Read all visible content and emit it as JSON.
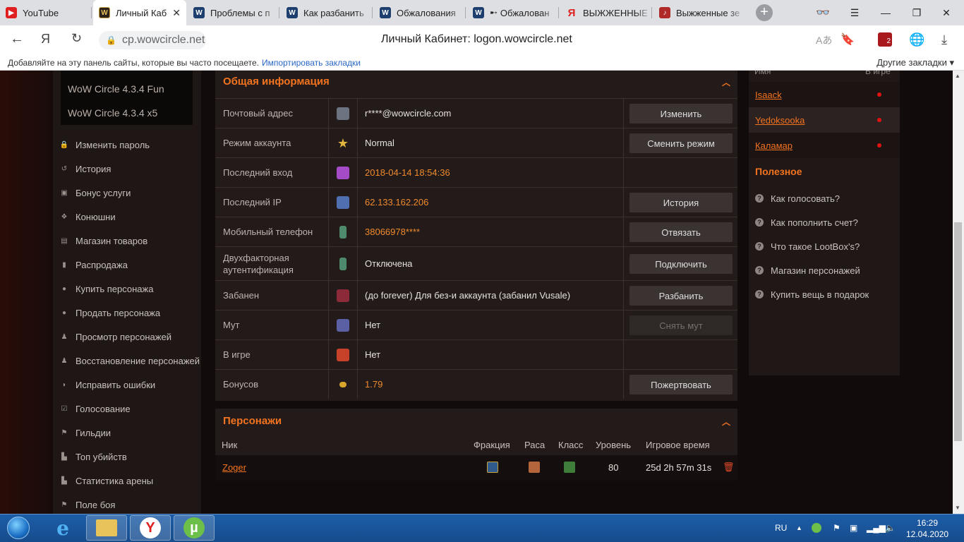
{
  "browser": {
    "tabs": [
      {
        "label": "YouTube",
        "icon": "youtube-icon"
      },
      {
        "label": "Личный Каб",
        "icon": "wowcircle-icon",
        "active": true
      },
      {
        "label": "Проблемы с п",
        "icon": "wow-icon"
      },
      {
        "label": "Как разбанить",
        "icon": "wow-icon"
      },
      {
        "label": "Обжалования",
        "icon": "wow-icon"
      },
      {
        "label": "Обжалован",
        "icon": "wow-icon"
      },
      {
        "label": "ВЫЖЖЕННЫЕ",
        "icon": "yandex-icon"
      },
      {
        "label": "Выжженные зе",
        "icon": "guitar-icon"
      }
    ],
    "url": "cp.wowcircle.net",
    "page_title": "Личный Кабинет: logon.wowcircle.net",
    "bookmarks_hint": "Добавляйте на эту панель сайты, которые вы часто посещаете.",
    "import_bookmarks": "Импортировать закладки",
    "other_bookmarks": "Другие закладки",
    "ext_badge": "2"
  },
  "left_menu": {
    "dropdown": [
      "WoW Circle 4.3.4 Fun",
      "WoW Circle 4.3.4 x5"
    ],
    "items": [
      {
        "label": "Изменить пароль",
        "icon": "lock-icon"
      },
      {
        "label": "История",
        "icon": "history-icon"
      },
      {
        "label": "Бонус услуги",
        "icon": "gift-icon"
      },
      {
        "label": "Конюшни",
        "icon": "paw-icon"
      },
      {
        "label": "Магазин товаров",
        "icon": "cart-icon"
      },
      {
        "label": "Распродажа",
        "icon": "bookmark-icon"
      },
      {
        "label": "Купить персонажа",
        "icon": "user-icon"
      },
      {
        "label": "Продать персонажа",
        "icon": "user-icon"
      },
      {
        "label": "Просмотр персонажей",
        "icon": "person-icon"
      },
      {
        "label": "Восстановление персонажей",
        "icon": "person-icon"
      },
      {
        "label": "Исправить ошибки",
        "icon": "shield-icon"
      },
      {
        "label": "Голосование",
        "icon": "checkbox-icon"
      },
      {
        "label": "Гильдии",
        "icon": "flag-icon"
      },
      {
        "label": "Топ убийств",
        "icon": "chart-icon"
      },
      {
        "label": "Статистика арены",
        "icon": "chart-icon"
      },
      {
        "label": "Поле боя",
        "icon": "flag-icon"
      }
    ]
  },
  "general_info": {
    "title": "Общая информация",
    "rows": [
      {
        "label": "Почтовый адрес",
        "value": "r****@wowcircle.com",
        "button": "Изменить",
        "icon_color": "#6b7280"
      },
      {
        "label": "Режим аккаунта",
        "value": "Normal",
        "button": "Сменить режим",
        "icon_color": "#e2b43b"
      },
      {
        "label": "Последний вход",
        "value": "2018-04-14 18:54:36",
        "button": "",
        "icon_color": "#a64bc8"
      },
      {
        "label": "Последний IP",
        "value": "62.133.162.206",
        "button": "История",
        "icon_color": "#4f6fb0"
      },
      {
        "label": "Мобильный телефон",
        "value": "38066978****",
        "button": "Отвязать",
        "icon_color": "#4e8a6c"
      },
      {
        "label": "Двухфакторная аутентификация",
        "value": "Отключена",
        "button": "Подключить",
        "icon_color": "#4e8a6c"
      },
      {
        "label": "Забанен",
        "value": "(до forever) Для без-и аккаунта (забанил Vusale)",
        "button": "Разбанить",
        "icon_color": "#8c2a3a"
      },
      {
        "label": "Мут",
        "value": "Нет",
        "button": "Снять мут",
        "icon_color": "#5b5fa3"
      },
      {
        "label": "В игре",
        "value": "Нет",
        "button": "",
        "icon_color": "#c8422a"
      },
      {
        "label": "Бонусов",
        "value": "1.79",
        "button": "Пожертвовать",
        "icon_color": "#d9a52a"
      }
    ]
  },
  "characters": {
    "title": "Персонажи",
    "columns": [
      "Ник",
      "Фракция",
      "Раса",
      "Класс",
      "Уровень",
      "Игровое время"
    ],
    "rows": [
      {
        "name": "Zoger",
        "level": "80",
        "played": "25d 2h 57m 31s"
      }
    ]
  },
  "right": {
    "friends_header": [
      "Имя",
      "В игре"
    ],
    "friends": [
      "Isaack",
      "Yedoksooka",
      "Каламар"
    ],
    "useful_title": "Полезное",
    "useful": [
      "Как голосовать?",
      "Как пополнить счет?",
      "Что такое LootBox's?",
      "Магазин персонажей",
      "Купить вещь в подарок"
    ]
  },
  "taskbar": {
    "lang": "RU",
    "time": "16:29",
    "date": "12.04.2020"
  }
}
